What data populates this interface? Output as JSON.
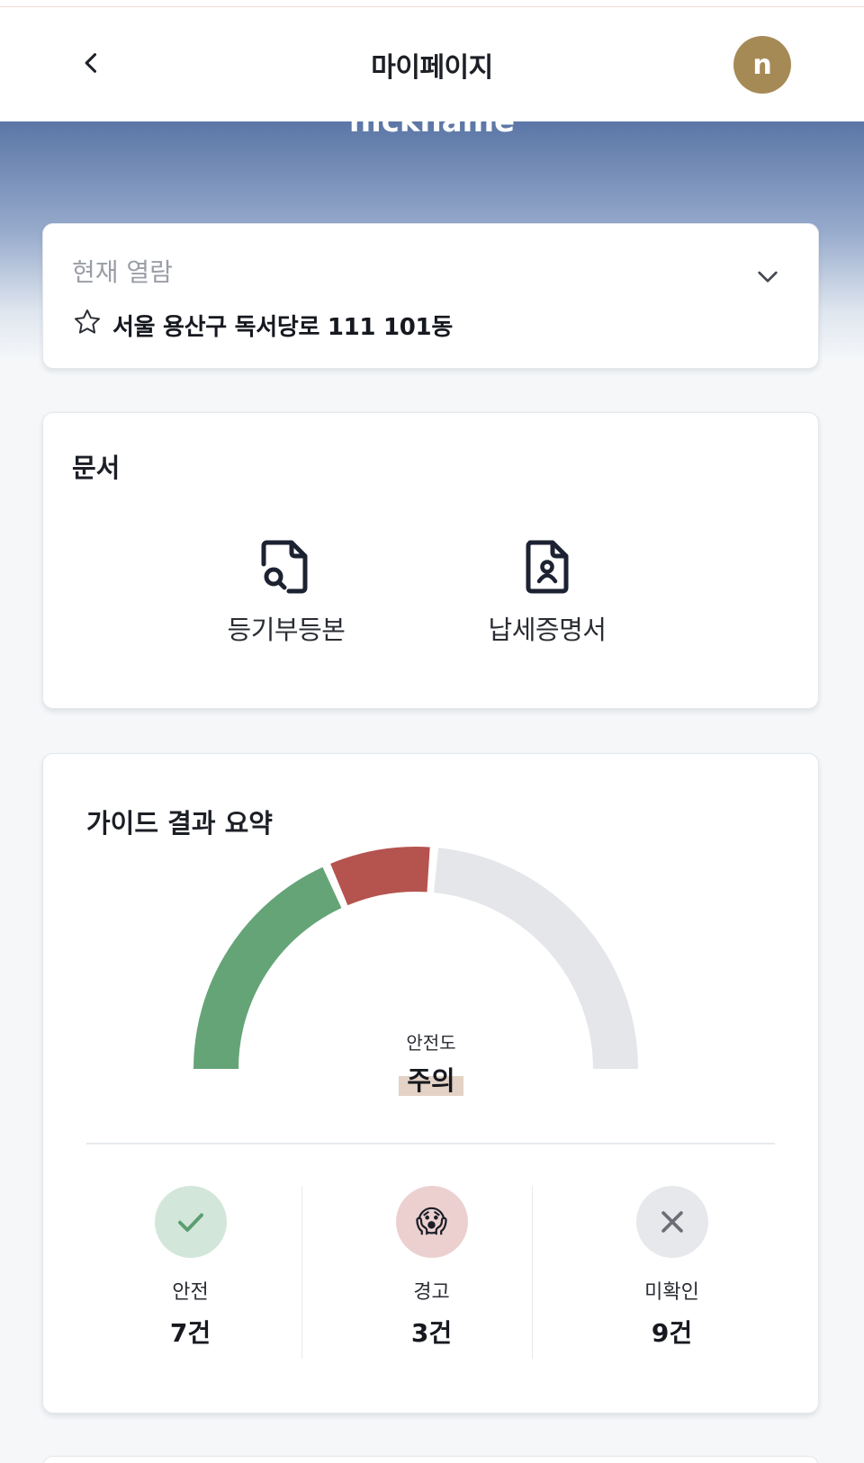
{
  "header": {
    "title": "마이페이지",
    "avatar_initial": "n"
  },
  "hero": {
    "nickname": "nickname"
  },
  "viewing": {
    "label": "현재 열람",
    "address": "서울 용산구 독서당로 111 101동"
  },
  "documents": {
    "title": "문서",
    "items": [
      {
        "label": "등기부등본",
        "icon": "document-search-icon"
      },
      {
        "label": "납세증명서",
        "icon": "document-person-icon"
      }
    ]
  },
  "guide": {
    "title": "가이드 결과 요약",
    "gauge": {
      "caption": "안전도",
      "status": "주의",
      "segments": [
        {
          "name": "안전",
          "count": 7,
          "color": "#65a477"
        },
        {
          "name": "경고",
          "count": 3,
          "color": "#b5534e"
        },
        {
          "name": "미확인",
          "count": 9,
          "color": "#e5e6ea"
        }
      ]
    },
    "stats": [
      {
        "label": "안전",
        "count": "7건",
        "icon": "check-icon",
        "bg": "#d3e6da",
        "fg": "#5b9d6f"
      },
      {
        "label": "경고",
        "count": "3건",
        "icon": "scream-emoji-icon",
        "glyph": "😱",
        "bg": "#ecd0d0",
        "fg": "#b5534e"
      },
      {
        "label": "미확인",
        "count": "9건",
        "icon": "close-icon",
        "bg": "#e7e8ec",
        "fg": "#6b6e75"
      }
    ]
  }
}
